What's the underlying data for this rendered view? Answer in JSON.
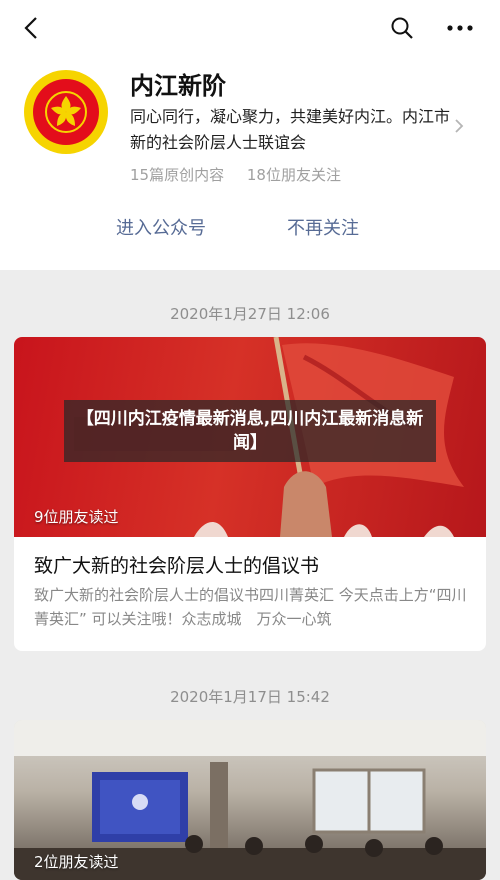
{
  "account": {
    "name": "内江新阶",
    "description": "同心同行，凝心聚力，共建美好内江。内江市新的社会阶层人士联谊会",
    "original_count": "15篇原创内容",
    "friends_following": "18位朋友关注"
  },
  "actions": {
    "enter_label": "进入公众号",
    "unfollow_label": "不再关注"
  },
  "articles": [
    {
      "date": "2020年1月27日 12:06",
      "read_count": "9位朋友读过",
      "title": "致广大新的社会阶层人士的倡议书",
      "summary": "致广大新的社会阶层人士的倡议书四川菁英汇 今天点击上方“四川菁英汇” 可以关注哦！众志成城　万众一心筑"
    },
    {
      "date": "2020年1月17日 15:42",
      "read_count": "2位朋友读过"
    }
  ],
  "overlay": {
    "text": "【四川内江疫情最新消息,四川内江最新消息新闻】"
  },
  "colors": {
    "accent_link": "#576b95",
    "logo_yellow": "#f6d400",
    "logo_red": "#e30d1b"
  }
}
